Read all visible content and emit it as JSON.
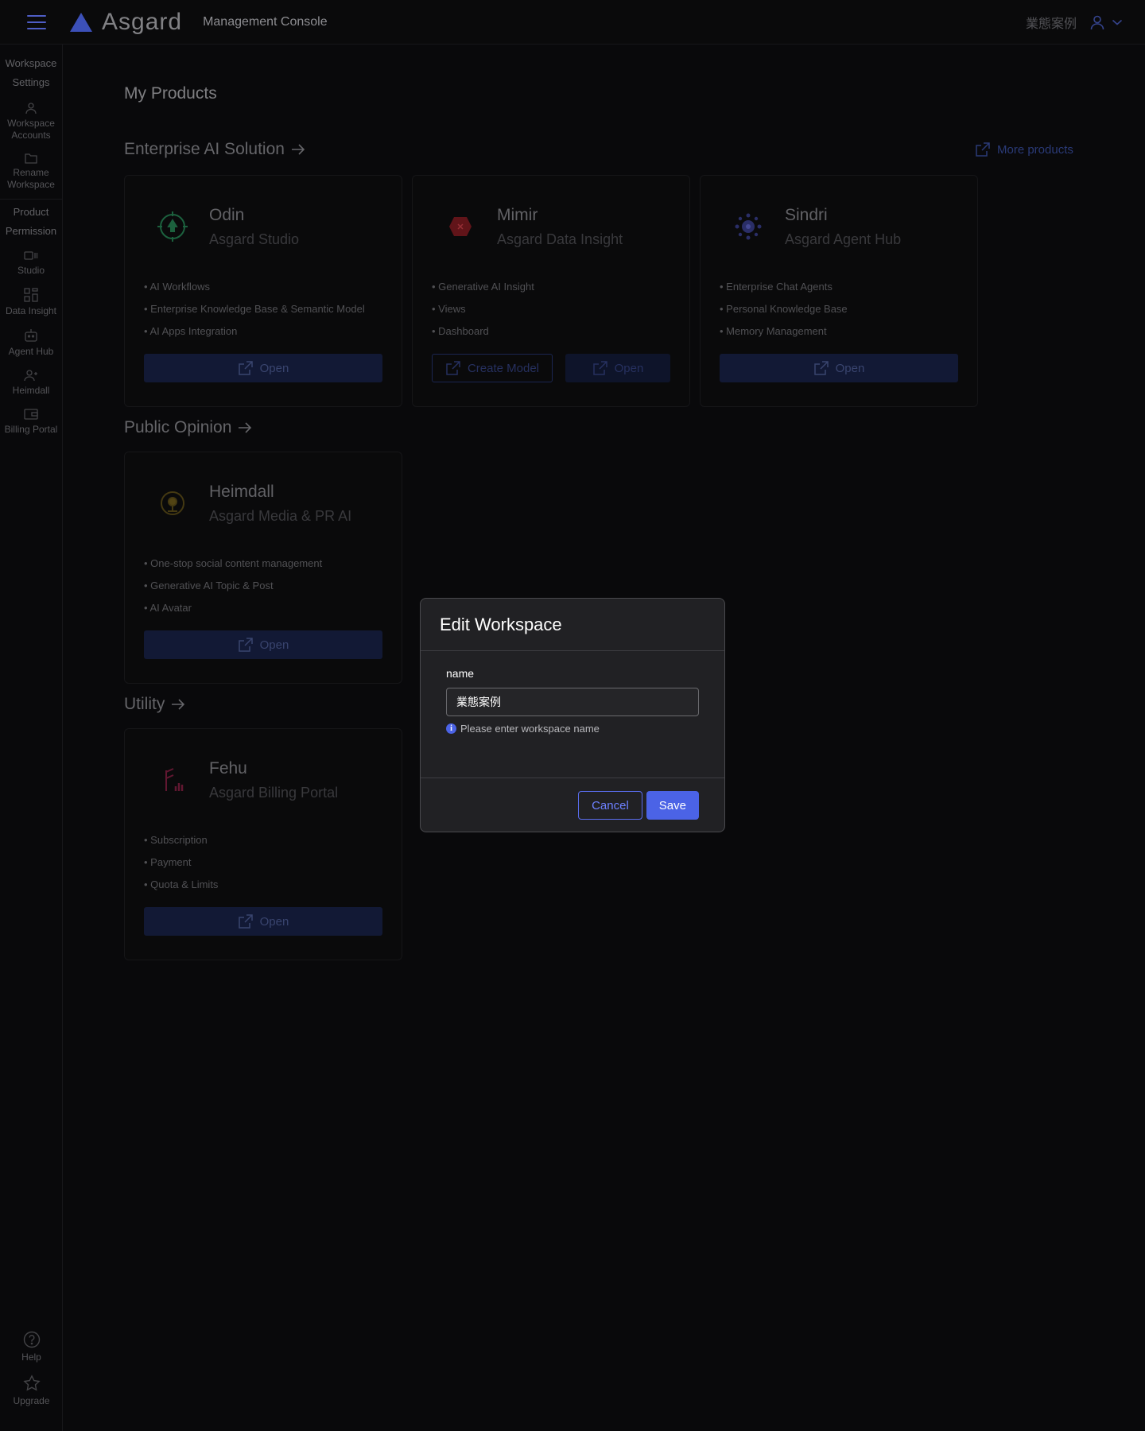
{
  "header": {
    "app_name": "Asgard",
    "console_title": "Management Console",
    "workspace_name": "業態案例"
  },
  "sidebar": {
    "groups": [
      {
        "label": "Workspace Settings",
        "items": [
          {
            "label": "Workspace Accounts",
            "icon": "user-icon"
          },
          {
            "label": "Rename Workspace",
            "icon": "folder-icon"
          }
        ]
      },
      {
        "label": "Product Permission",
        "items": [
          {
            "label": "Studio",
            "icon": "studio-icon"
          },
          {
            "label": "Data Insight",
            "icon": "grid-icon"
          },
          {
            "label": "Agent Hub",
            "icon": "robot-icon"
          },
          {
            "label": "Heimdall",
            "icon": "users-icon"
          },
          {
            "label": "Billing Portal",
            "icon": "wallet-icon"
          }
        ]
      }
    ],
    "bottom": [
      {
        "label": "Help",
        "icon": "help-icon"
      },
      {
        "label": "Upgrade",
        "icon": "star-icon"
      }
    ]
  },
  "main": {
    "title": "My Products",
    "more_products": "More products",
    "sections": [
      {
        "title": "Enterprise AI Solution",
        "cards": [
          {
            "name": "Odin",
            "subtitle": "Asgard Studio",
            "color": "#1f7a4a",
            "features": [
              "AI Workflows",
              "Enterprise Knowledge Base & Semantic Model",
              "AI Apps Integration"
            ],
            "open_label": "Open"
          },
          {
            "name": "Mimir",
            "subtitle": "Asgard Data Insight",
            "color": "#8a1e24",
            "features": [
              "Generative AI Insight",
              "Views",
              "Dashboard"
            ],
            "create_label": "Create Model",
            "open_label": "Open"
          },
          {
            "name": "Sindri",
            "subtitle": "Asgard Agent Hub",
            "color": "#3a3f8a",
            "features": [
              "Enterprise Chat Agents",
              "Personal Knowledge Base",
              "Memory Management"
            ],
            "open_label": "Open"
          }
        ]
      },
      {
        "title": "Public Opinion",
        "cards": [
          {
            "name": "Heimdall",
            "subtitle": "Asgard Media & PR AI",
            "color": "#6a5a1e",
            "features": [
              "One-stop social content management",
              "Generative AI Topic & Post",
              "AI Avatar"
            ],
            "open_label": "Open"
          }
        ]
      },
      {
        "title": "Utility",
        "cards": [
          {
            "name": "Fehu",
            "subtitle": "Asgard Billing Portal",
            "color": "#7a1f3e",
            "features": [
              "Subscription",
              "Payment",
              "Quota & Limits"
            ],
            "open_label": "Open"
          }
        ]
      }
    ]
  },
  "modal": {
    "title": "Edit Workspace",
    "field_label": "name",
    "field_value": "業態案例",
    "hint": "Please enter workspace name",
    "cancel_label": "Cancel",
    "save_label": "Save"
  }
}
